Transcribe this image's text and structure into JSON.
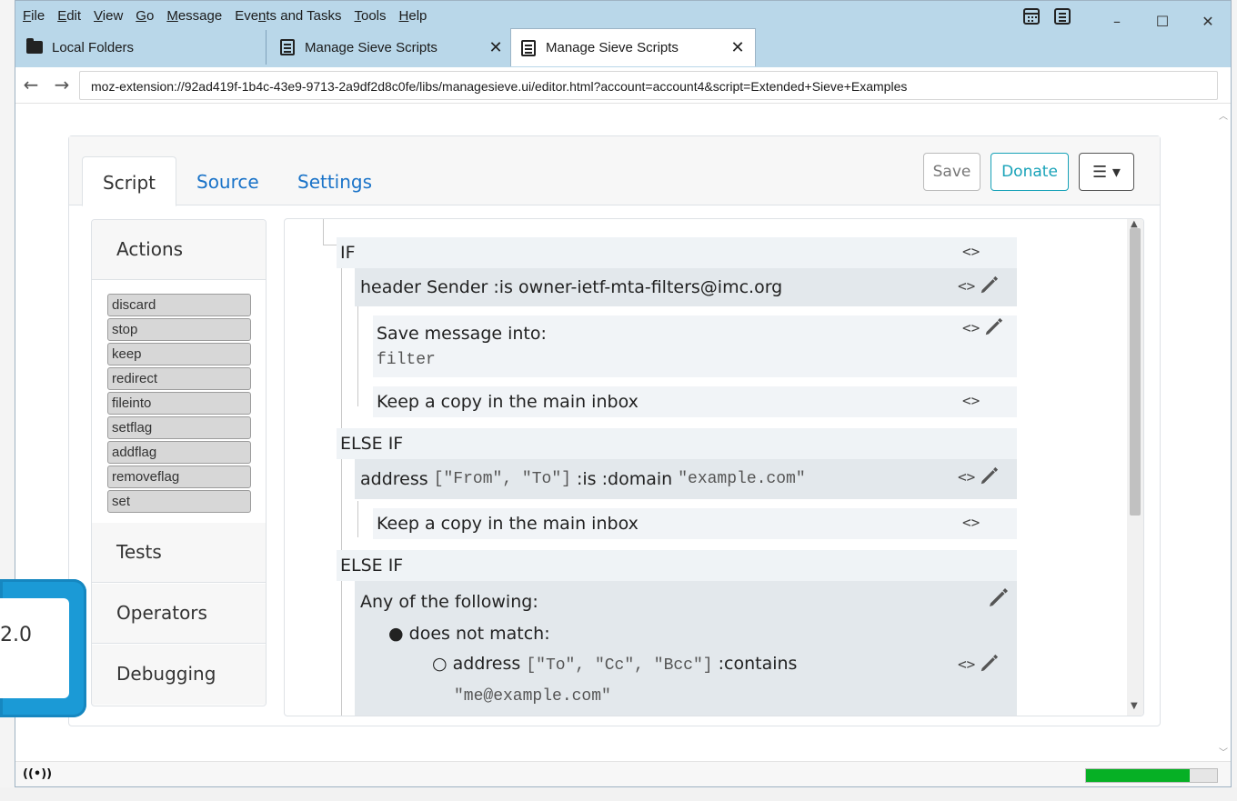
{
  "menu": {
    "file": {
      "u": "F",
      "rest": "ile"
    },
    "edit": {
      "u": "E",
      "rest": "dit"
    },
    "view": {
      "u": "V",
      "rest": "iew"
    },
    "go": {
      "u": "G",
      "rest": "o"
    },
    "message": {
      "u": "M",
      "rest": "essage"
    },
    "events": {
      "pre": "Eve",
      "u": "n",
      "rest": "ts and Tasks"
    },
    "tools": {
      "u": "T",
      "rest": "ools"
    },
    "help": {
      "u": "H",
      "rest": "elp"
    }
  },
  "window_controls": {
    "minimize": "–",
    "maximize": "☐",
    "close": "✕"
  },
  "tabs": [
    {
      "label": "Local Folders",
      "icon": "folder-icon"
    },
    {
      "label": "Manage Sieve Scripts",
      "icon": "document-icon",
      "close": "✕"
    },
    {
      "label": "Manage Sieve Scripts",
      "icon": "document-icon",
      "close": "✕",
      "active": true
    }
  ],
  "nav": {
    "back": "←",
    "forward": "→",
    "url": "moz-extension://92ad419f-1b4c-43e9-9713-2a9df2d8c0fe/libs/managesieve.ui/editor.html?account=account4&script=Extended+Sieve+Examples"
  },
  "editor_tabs": {
    "script": "Script",
    "source": "Source",
    "settings": "Settings"
  },
  "header_buttons": {
    "save": "Save",
    "donate": "Donate",
    "menu": "☰ ▾"
  },
  "sidebar": {
    "actions_title": "Actions",
    "actions": [
      "discard",
      "stop",
      "keep",
      "redirect",
      "fileinto",
      "setflag",
      "addflag",
      "removeflag",
      "set"
    ],
    "tests_title": "Tests",
    "operators_title": "Operators",
    "debugging_title": "Debugging"
  },
  "script_tree": {
    "if_label": "IF",
    "test1": "header Sender :is owner-ietf-mta-filters@imc.org",
    "save_into": "Save message into:",
    "folder": "filter",
    "keep_copy": "Keep a copy in the main inbox",
    "elseif_label": "ELSE IF",
    "test2_a": "address",
    "test2_b": "[\"From\", \"To\"]",
    "test2_c": ":is :domain",
    "test2_d": "\"example.com\"",
    "keep_copy_2": "Keep a copy in the main inbox",
    "elseif_label_2": "ELSE IF",
    "anyof": "Any of the following:",
    "does_not_match": "does not match:",
    "test3_a": "address",
    "test3_b": "[\"To\", \"Cc\", \"Bcc\"]",
    "test3_c": ":contains",
    "test3_d": "\"me@example.com\"",
    "code_toggle": "<>"
  },
  "status": {
    "progress_fraction": 0.79,
    "progress_color": "#06b025"
  },
  "overlay": {
    "text": "2.0"
  },
  "colors": {
    "accent": "#1a73c8",
    "donate": "#17a2b8",
    "titlebar": "#b9d7e9"
  }
}
